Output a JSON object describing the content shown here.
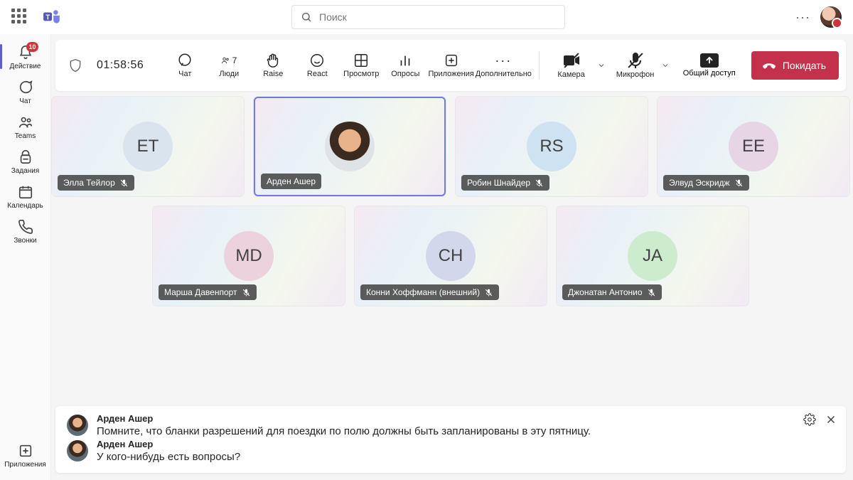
{
  "search": {
    "placeholder": "Поиск"
  },
  "rail": {
    "activity": "Действие",
    "activity_badge": "10",
    "chat": "Чат",
    "teams": "Teams",
    "assignments": "Задания",
    "calendar": "Календарь",
    "calls": "Звонки",
    "apps": "Приложения"
  },
  "toolbar": {
    "timer": "01:58:56",
    "chat": "Чат",
    "people": "Люди",
    "people_count": "7",
    "raise": "Raise",
    "react": "React",
    "view": "Просмотр",
    "polls": "Опросы",
    "apps": "Приложения",
    "more": "Дополнительно",
    "camera": "Камера",
    "mic": "Микрофон",
    "share": "Общий доступ",
    "leave": "Покидать"
  },
  "participants": {
    "r1": [
      {
        "initials": "ET",
        "name": "Элла Тейлор",
        "muted": true,
        "bg": "#d9e4ef",
        "hl": false,
        "photo": false
      },
      {
        "initials": "",
        "name": "Арден Ашер",
        "muted": false,
        "bg": "",
        "hl": true,
        "photo": true
      },
      {
        "initials": "RS",
        "name": "Робин Шнайдер",
        "muted": true,
        "bg": "#cfe2f1",
        "hl": false,
        "photo": false
      },
      {
        "initials": "EE",
        "name": "Элвуд Эскридж",
        "muted": true,
        "bg": "#e7d5e6",
        "hl": false,
        "photo": false
      }
    ],
    "r2": [
      {
        "initials": "MD",
        "name": "Марша Давенпорт",
        "muted": true,
        "bg": "#ecd2dc",
        "hl": false,
        "photo": false
      },
      {
        "initials": "CH",
        "name": "Конни Хоффманн (внешний)",
        "muted": true,
        "bg": "#d2d7eb",
        "hl": false,
        "photo": false
      },
      {
        "initials": "JA",
        "name": "Джонатан Антонио",
        "muted": true,
        "bg": "#cdeccd",
        "hl": false,
        "photo": false
      }
    ]
  },
  "captions": [
    {
      "name": "Арден Ашер",
      "text": "Помните, что бланки разрешений для поездки по полю должны быть запланированы в эту пятницу."
    },
    {
      "name": "Арден Ашер",
      "text": "У кого-нибудь есть вопросы?"
    }
  ]
}
